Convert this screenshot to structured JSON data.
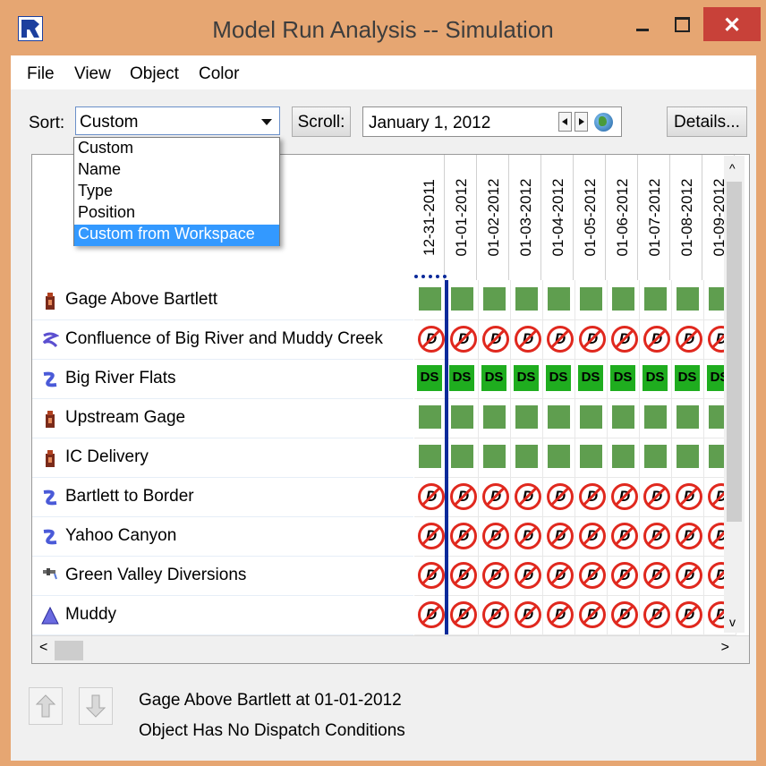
{
  "window": {
    "title": "Model Run Analysis -- Simulation",
    "close_glyph": "✕"
  },
  "menu": [
    "File",
    "View",
    "Object",
    "Color"
  ],
  "sort": {
    "label": "Sort:",
    "value": "Custom",
    "options": [
      "Custom",
      "Name",
      "Type",
      "Position",
      "Custom from Workspace"
    ],
    "highlighted": "Custom from Workspace"
  },
  "scroll": {
    "label": "Scroll:",
    "date": "January 1, 2012"
  },
  "details_label": "Details...",
  "dates": [
    "12-31-2011",
    "01-01-2012",
    "01-02-2012",
    "01-03-2012",
    "01-04-2012",
    "01-05-2012",
    "01-06-2012",
    "01-07-2012",
    "01-08-2012",
    "01-09-2012"
  ],
  "objects": [
    {
      "name": "Gage Above Bartlett",
      "icon": "gage-icon",
      "status": "gage"
    },
    {
      "name": "Confluence of Big River and Muddy Creek",
      "icon": "confluence-icon",
      "status": "no-dispatch"
    },
    {
      "name": "Big River Flats",
      "icon": "reach-icon",
      "status": "dispatch"
    },
    {
      "name": "Upstream Gage",
      "icon": "gage-icon",
      "status": "gage"
    },
    {
      "name": "IC Delivery",
      "icon": "gage-icon",
      "status": "gage"
    },
    {
      "name": "Bartlett to Border",
      "icon": "reach-icon",
      "status": "no-dispatch"
    },
    {
      "name": "Yahoo Canyon",
      "icon": "reach-icon",
      "status": "no-dispatch"
    },
    {
      "name": "Green Valley Diversions",
      "icon": "diversion-icon",
      "status": "no-dispatch"
    },
    {
      "name": "Muddy",
      "icon": "reservoir-icon",
      "status": "no-dispatch"
    }
  ],
  "cell_glyphs": {
    "dispatch": "DS",
    "no_dispatch": "D"
  },
  "status_lines": [
    "Gage Above Bartlett at 01-01-2012",
    "Object Has No Dispatch Conditions"
  ],
  "colors": {
    "titlebar": "#e6a672",
    "close": "#c84139",
    "dispatched": "#1fad1f",
    "gage_cell": "#5f9e4f",
    "no_dispatch_ring": "#e0281e",
    "selection": "#3399ff",
    "current_date_line": "#0b2a9a"
  }
}
